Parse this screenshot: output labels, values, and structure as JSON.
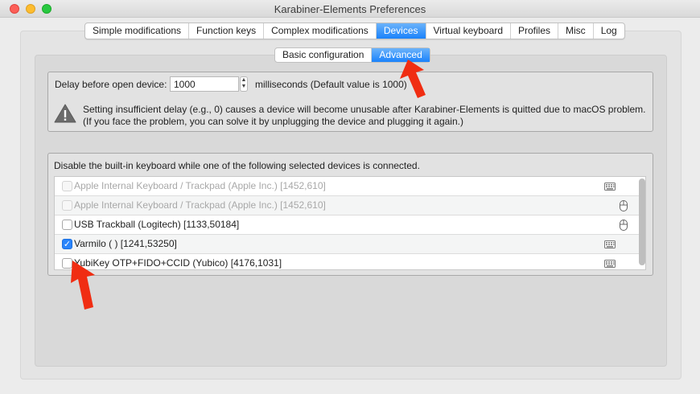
{
  "window": {
    "title": "Karabiner-Elements Preferences"
  },
  "tabs": [
    {
      "label": "Simple modifications",
      "active": false
    },
    {
      "label": "Function keys",
      "active": false
    },
    {
      "label": "Complex modifications",
      "active": false
    },
    {
      "label": "Devices",
      "active": true
    },
    {
      "label": "Virtual keyboard",
      "active": false
    },
    {
      "label": "Profiles",
      "active": false
    },
    {
      "label": "Misc",
      "active": false
    },
    {
      "label": "Log",
      "active": false
    }
  ],
  "subtabs": [
    {
      "label": "Basic configuration",
      "active": false
    },
    {
      "label": "Advanced",
      "active": true
    }
  ],
  "delay": {
    "label": "Delay before open device:",
    "value": "1000",
    "unit_text": "milliseconds (Default value is 1000)"
  },
  "warning": {
    "line1": "Setting insufficient delay (e.g., 0) causes a device will become unusable after Karabiner-Elements is quitted due to macOS problem.",
    "line2": "(If you face the problem, you can solve it by unplugging the device and plugging it again.)"
  },
  "devices": {
    "heading": "Disable the built-in keyboard while one of the following selected devices is connected.",
    "items": [
      {
        "name": "Apple Internal Keyboard / Trackpad (Apple Inc.) [1452,610]",
        "checked": false,
        "disabled": true,
        "icon": "keyboard-icon"
      },
      {
        "name": "Apple Internal Keyboard / Trackpad (Apple Inc.) [1452,610]",
        "checked": false,
        "disabled": true,
        "icon": "mouse-icon"
      },
      {
        "name": "USB Trackball (Logitech) [1133,50184]",
        "checked": false,
        "disabled": false,
        "icon": "mouse-icon"
      },
      {
        "name": "Varmilo ( ) [1241,53250]",
        "checked": true,
        "disabled": false,
        "icon": "keyboard-icon"
      },
      {
        "name": "YubiKey OTP+FIDO+CCID (Yubico) [4176,1031]",
        "checked": false,
        "disabled": false,
        "icon": "keyboard-icon"
      }
    ]
  },
  "colors": {
    "accent": "#1a82fb",
    "annotation_arrow": "#f02d12"
  }
}
